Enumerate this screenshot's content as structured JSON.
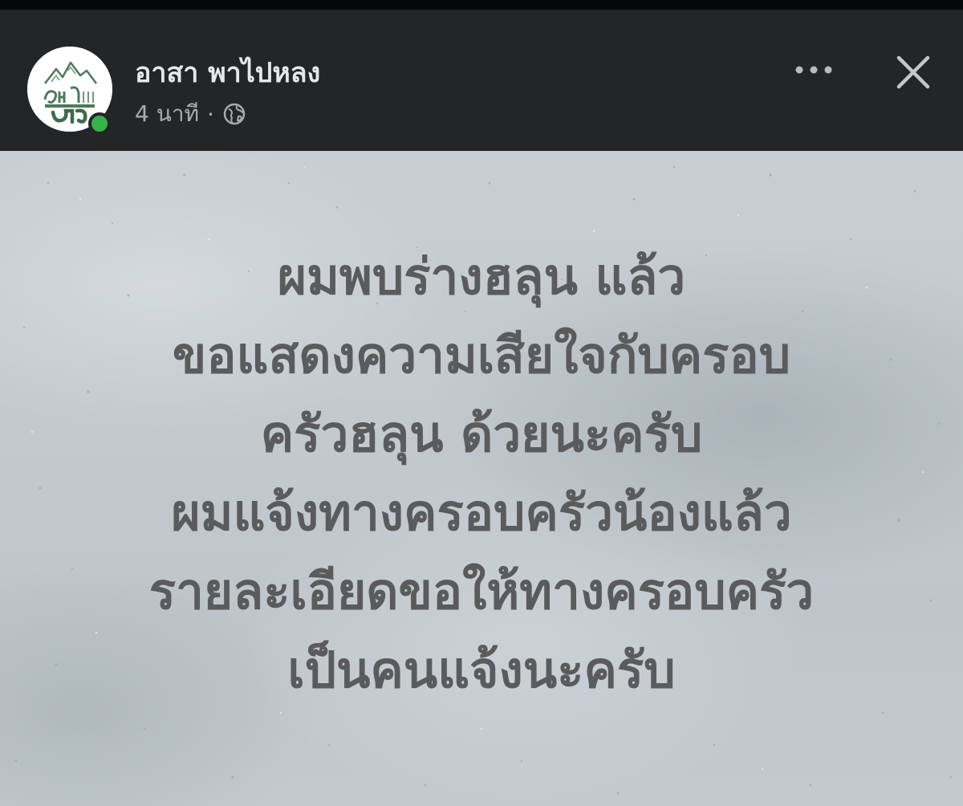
{
  "header": {
    "page_name": "อาสา พาไปหลง",
    "time": "4 นาที",
    "separator": "·",
    "privacy_icon": "globe-icon",
    "more_icon": "more-horizontal-icon",
    "close_icon": "close-icon",
    "avatar_text": "อาสา พาไปหลง",
    "online": true
  },
  "post": {
    "lines": [
      "ผมพบร่างฮลุน แล้ว",
      "ขอแสดงความเสียใจกับครอบ",
      "ครัวฮลุน ด้วยนะครับ",
      "ผมแจ้งทางครอบครัวน้องแล้ว",
      "รายละเอียดขอให้ทางครอบครัว",
      "เป็นคนแจ้งนะครับ"
    ]
  },
  "colors": {
    "header_bg": "#242527",
    "name_text": "#e6e7e9",
    "meta_text": "#a8abb0",
    "online": "#35b34a",
    "post_text": "#5a5b5d",
    "post_bg": "#c3cbd0",
    "logo_green": "#4d7a5c"
  }
}
